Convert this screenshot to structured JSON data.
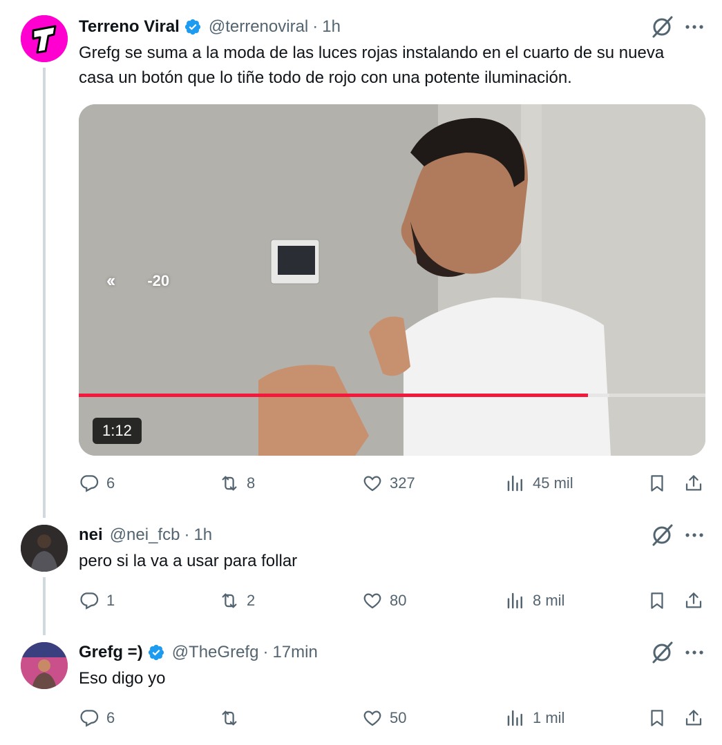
{
  "tweets": [
    {
      "name": "Terreno Viral",
      "handle": "@terrenoviral",
      "time": "1h",
      "text": "Grefg se suma a la moda de las luces rojas instalando en el cuarto de su nueva casa un botón que lo tiñe todo de rojo con una potente iluminación.",
      "verified": true,
      "video": {
        "duration": "1:12",
        "rewind_label": "-20",
        "progress": 0.813,
        "buffered": 0.847
      },
      "stats": {
        "replies": "6",
        "retweets": "8",
        "likes": "327",
        "views": "45 mil"
      }
    },
    {
      "name": "nei",
      "handle": "@nei_fcb",
      "time": "1h",
      "text": "pero si la va a usar para follar",
      "verified": false,
      "stats": {
        "replies": "1",
        "retweets": "2",
        "likes": "80",
        "views": "8 mil"
      }
    },
    {
      "name": "Grefg =)",
      "handle": "@TheGrefg",
      "time": "17min",
      "text": "Eso digo yo",
      "verified": true,
      "stats": {
        "replies": "6",
        "retweets": "",
        "likes": "50",
        "views": "1 mil"
      }
    }
  ],
  "colors": {
    "accent": "#1d9bf0",
    "muted": "#536471",
    "thread": "#cfd9de",
    "progress": "#f4193c",
    "brand_avatar": "#ff00c8"
  },
  "dot": "·"
}
